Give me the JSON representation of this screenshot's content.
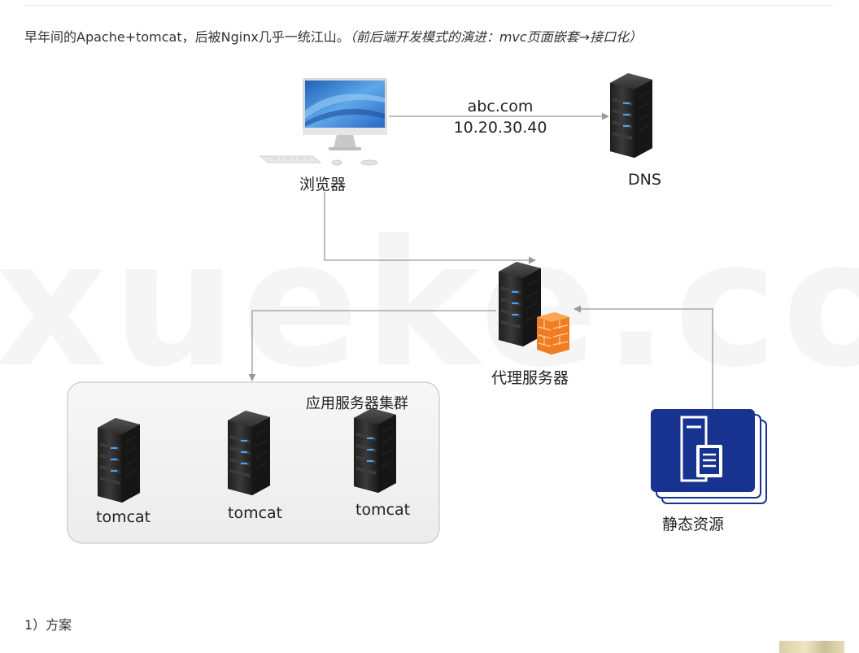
{
  "intro": {
    "main": "早年间的Apache+tomcat，后被Nginx几乎一统江山。",
    "aside": "（前后端开发模式的演进：mvc页面嵌套→接口化）"
  },
  "watermark": "xueke.com",
  "diagram": {
    "browser_label": "浏览器",
    "dns_label": "DNS",
    "domain_text": "abc.com",
    "ip_text": "10.20.30.40",
    "proxy_label": "代理服务器",
    "cluster_label": "应用服务器集群",
    "servers": [
      {
        "label": "tomcat"
      },
      {
        "label": "tomcat"
      },
      {
        "label": "tomcat"
      }
    ],
    "static_label": "静态资源",
    "colors": {
      "server_body": "#2b2b2b",
      "server_light": "#4aa3ff",
      "firewall": "#f28a2e",
      "static_blue": "#17338f",
      "connector": "#999999"
    }
  },
  "plan_label": "1）方案"
}
